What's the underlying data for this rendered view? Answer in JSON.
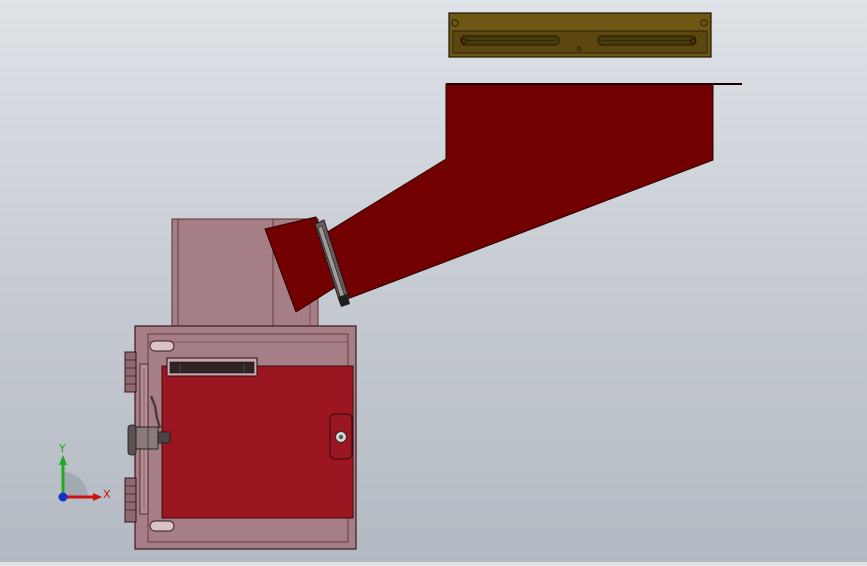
{
  "viewport": {
    "background_top": "#dfe3e8",
    "background_bottom": "#b3b9c2"
  },
  "colors": {
    "chute_red": "#720000",
    "body_red": "#9c1622",
    "housing_pink": "#a67e86",
    "frame_brown": "#6e5714",
    "edge_dark": "#2a0a0c"
  },
  "triad": {
    "x_label": "X",
    "y_label": "Y",
    "x_color": "#cc1111",
    "y_color": "#22aa22",
    "z_color": "#1133cc"
  }
}
